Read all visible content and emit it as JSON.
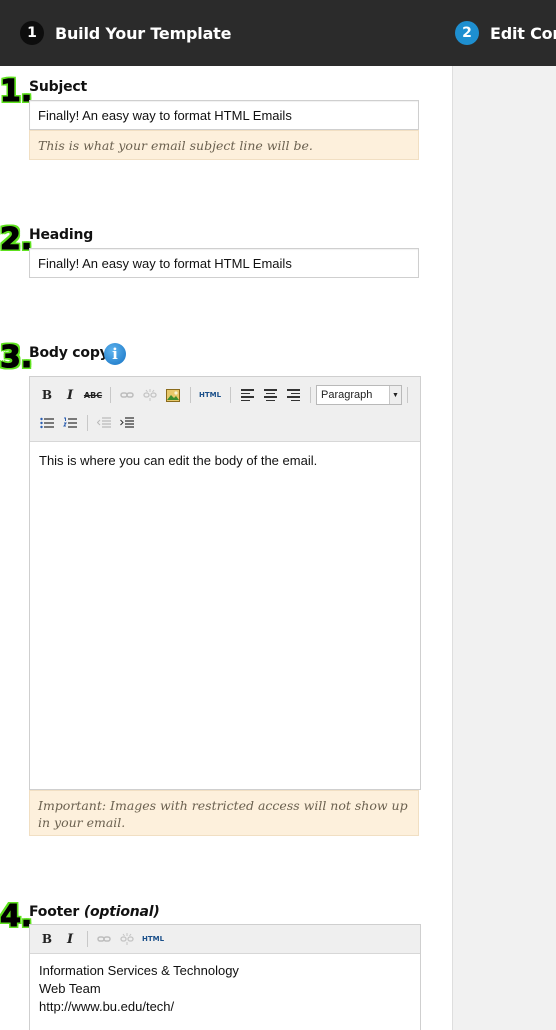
{
  "steps": [
    {
      "number": "1",
      "label": "Build Your Template"
    },
    {
      "number": "2",
      "label": "Edit Content"
    }
  ],
  "subject": {
    "step": "1.",
    "label": "Subject",
    "value": "Finally! An easy way to format HTML Emails",
    "hint": "This is what your email subject line will be."
  },
  "heading": {
    "step": "2.",
    "label": "Heading",
    "value": "Finally! An easy way to format HTML Emails"
  },
  "body": {
    "step": "3.",
    "label": "Body copy",
    "info_icon": "i",
    "format_value": "Paragraph",
    "content": "This is where you can edit the body of the email.",
    "note": "Important: Images with restricted access will not show up in your email."
  },
  "footer": {
    "step": "4.",
    "label": "Footer",
    "label_suffix": "(optional)",
    "lines": [
      "Information Services & Technology",
      "Web Team",
      "http://www.bu.edu/tech/"
    ]
  },
  "toolbar": {
    "bold": "B",
    "italic": "I",
    "strike": "ABC",
    "html": "HTML"
  },
  "colors": {
    "topbar": "#2b2b2b",
    "step_active": "#1e8fd0",
    "step_number_outline": "#5ee11e",
    "hint_bg": "#fdf0dc"
  }
}
